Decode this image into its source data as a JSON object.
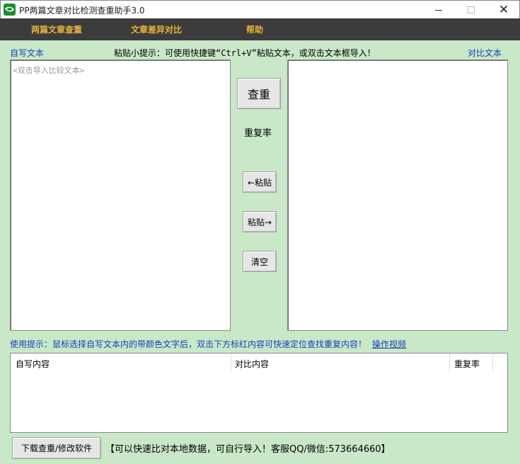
{
  "window": {
    "title": "PP两篇文章对比检测查重助手3.0",
    "minimize": "minimize",
    "maximize": "maximize",
    "close": "✕"
  },
  "menu": {
    "items": [
      {
        "label": "两篇文章查重"
      },
      {
        "label": "文章差异对比"
      },
      {
        "label": "帮助"
      }
    ],
    "accent_color": "#e8b13c",
    "bar_color": "#3c3c3c"
  },
  "labels": {
    "left_title": "自写文本",
    "right_title": "对比文本",
    "paste_hint": "粘贴小提示：可使用快捷键“Ctrl+V”粘贴文本，或双击文本框导入！",
    "link_color": "#1a3fb8"
  },
  "left_textbox": {
    "placeholder": "<双击导入比较文本>",
    "value": ""
  },
  "right_textbox": {
    "value": ""
  },
  "controls": {
    "check_button": "查重",
    "rate_label": "重复率",
    "paste_left_button": "←粘贴",
    "paste_right_button": "粘贴→",
    "clear_button": "清空"
  },
  "usage": {
    "hint": "使用提示：鼠标选择自写文本内的带颜色文字后，双击下方标红内容可快速定位查找重复内容！",
    "video_link": "操作视频"
  },
  "results_table": {
    "columns": [
      "自写内容",
      "对比内容",
      "重复率"
    ],
    "rows": []
  },
  "footer": {
    "download_button": "下载查重/修改软件",
    "text": "【可以快速比对本地数据，可自行导入！客服QQ/微信:573664660】"
  },
  "background_color": "#c8e8c8"
}
